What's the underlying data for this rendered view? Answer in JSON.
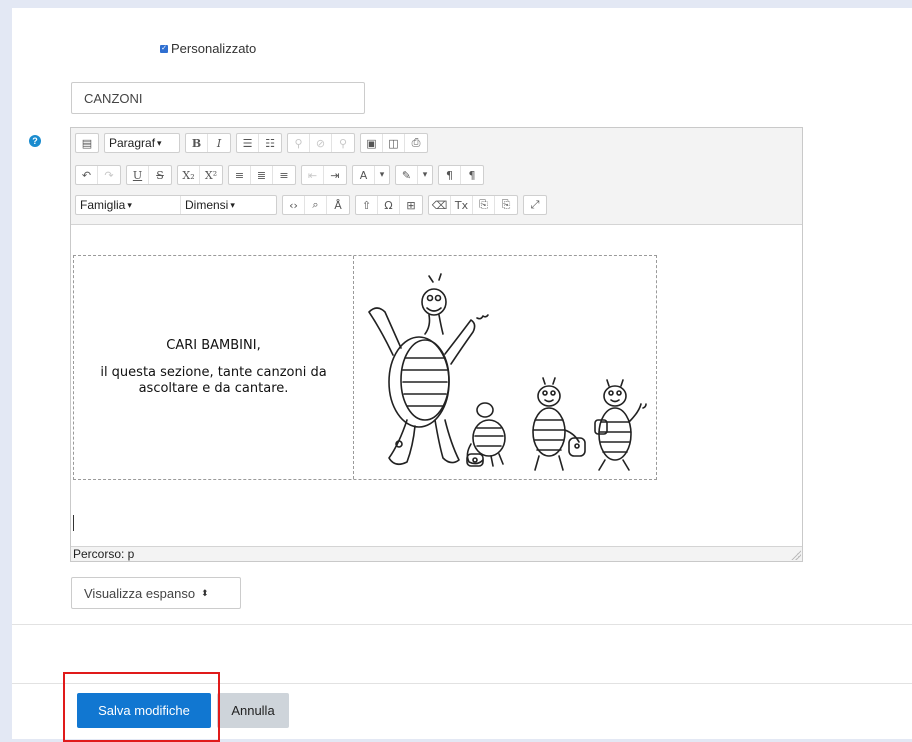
{
  "form": {
    "checkbox_label": "Personalizzato",
    "title_value": "CANZONI"
  },
  "toolbar": {
    "paragraph_select": "Paragraf",
    "font_family_select": "Famiglia",
    "font_size_select": "Dimensi"
  },
  "content": {
    "heading": "CARI BAMBINI,",
    "body": "il questa sezione, tante canzoni da ascoltare e da cantare."
  },
  "statusbar": {
    "path": "Percorso: p"
  },
  "display_select": {
    "value": "Visualizza espanso"
  },
  "actions": {
    "save_label": "Salva modifiche",
    "cancel_label": "Annulla"
  },
  "colors": {
    "accent": "#1177d1",
    "highlight": "#e01a1a",
    "help_icon": "#1a8ccf"
  }
}
